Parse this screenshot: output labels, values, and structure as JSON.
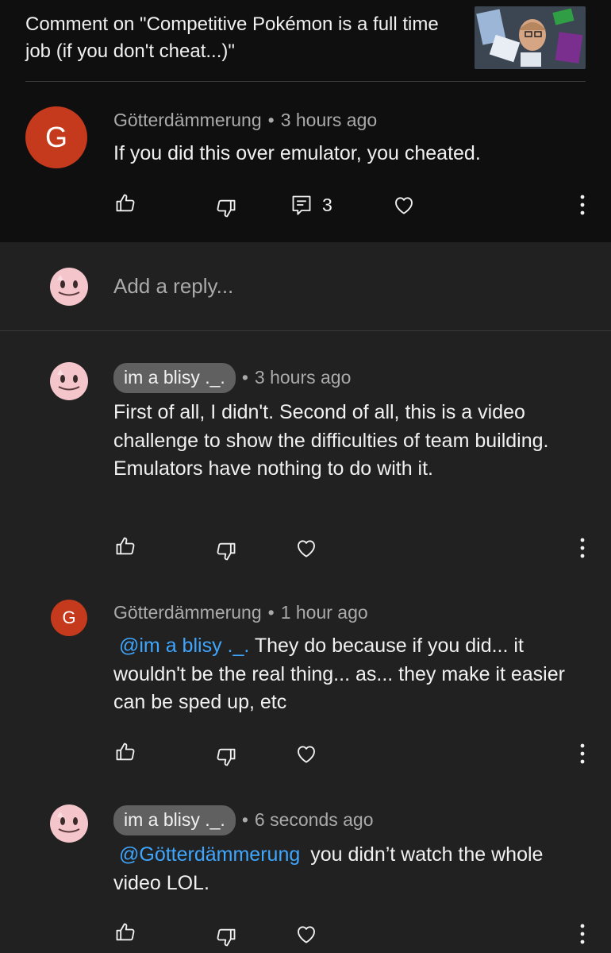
{
  "header": {
    "title": "Comment on \"Competitive Pokémon is a full time job (if you don't cheat...)\""
  },
  "comment": {
    "avatar_letter": "G",
    "author": "Götterdämmerung",
    "time": "3 hours ago",
    "text": "If you did this over emulator, you cheated.",
    "reply_count": "3"
  },
  "reply_input": {
    "placeholder": "Add a reply..."
  },
  "replies": [
    {
      "author": "im a blisy ._.",
      "time": "3 hours ago",
      "text": "First of all, I didn't. Second of all, this is a video challenge to show the difficulties of team building. Emulators have nothing to do with it."
    },
    {
      "avatar_letter": "G",
      "author": "Götterdämmerung",
      "time": "1 hour ago",
      "mention": "@im a blisy ._.",
      "text": "They do because if you did... it wouldn't be the real thing... as... they make it easier can be sped up, etc"
    },
    {
      "author": "im a blisy ._.",
      "time": "6 seconds ago",
      "mention": "@Götterdämmerung",
      "text": "you didn’t watch the whole video LOL."
    }
  ],
  "colors": {
    "background": "#212121",
    "header_background": "#0f0f0f",
    "avatar_red": "#c53a1c",
    "mention_blue": "#3ea6ff",
    "chip_gray": "#606060"
  }
}
